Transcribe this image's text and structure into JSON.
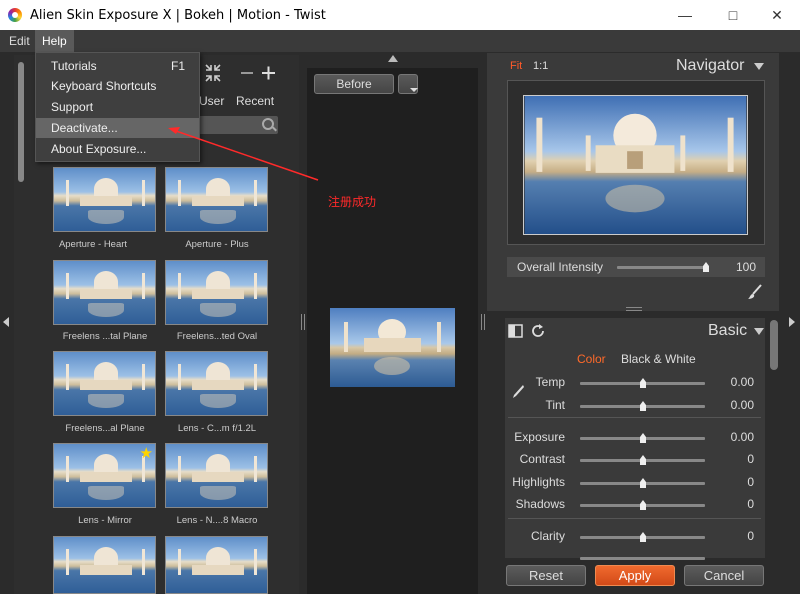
{
  "window": {
    "title": "Alien Skin Exposure X | Bokeh | Motion - Twist"
  },
  "menubar": {
    "items": [
      "Edit",
      "Help"
    ]
  },
  "help_menu": {
    "items": [
      {
        "label": "Tutorials",
        "shortcut": "F1"
      },
      {
        "label": "Keyboard Shortcuts"
      },
      {
        "label": "Support"
      },
      {
        "label": "Deactivate..."
      },
      {
        "label": "About Exposure..."
      }
    ]
  },
  "presets": {
    "tabs": [
      "User",
      "Recent"
    ],
    "thumbs": [
      {
        "label": "Aperture - Heart"
      },
      {
        "label": "Aperture - Plus"
      },
      {
        "label": "Freelens ...tal Plane"
      },
      {
        "label": "Freelens...ted Oval"
      },
      {
        "label": "Freelens...al Plane"
      },
      {
        "label": "Lens - C...m f/1.2L"
      },
      {
        "label": "Lens - Mirror",
        "favorite": true
      },
      {
        "label": "Lens - N....8 Macro"
      }
    ]
  },
  "annotation": {
    "text": "注册成功",
    "color": "#ff2a2a"
  },
  "compare": {
    "before_label": "Before"
  },
  "navigator": {
    "fit": "Fit",
    "one_to_one": "1:1",
    "title": "Navigator",
    "intensity_label": "Overall Intensity",
    "intensity_value": "100",
    "intensity_level": 1.0
  },
  "basic": {
    "title": "Basic",
    "tab_color": "Color",
    "tab_bw": "Black & White",
    "sliders": [
      {
        "label": "Temp",
        "value": "0.00"
      },
      {
        "label": "Tint",
        "value": "0.00"
      },
      {
        "label": "Exposure",
        "value": "0.00"
      },
      {
        "label": "Contrast",
        "value": "0"
      },
      {
        "label": "Highlights",
        "value": "0"
      },
      {
        "label": "Shadows",
        "value": "0"
      },
      {
        "label": "Clarity",
        "value": "0"
      }
    ]
  },
  "footer": {
    "reset": "Reset",
    "apply": "Apply",
    "cancel": "Cancel"
  },
  "colors": {
    "accent": "#e8592a",
    "panel": "#3a3a3a"
  }
}
